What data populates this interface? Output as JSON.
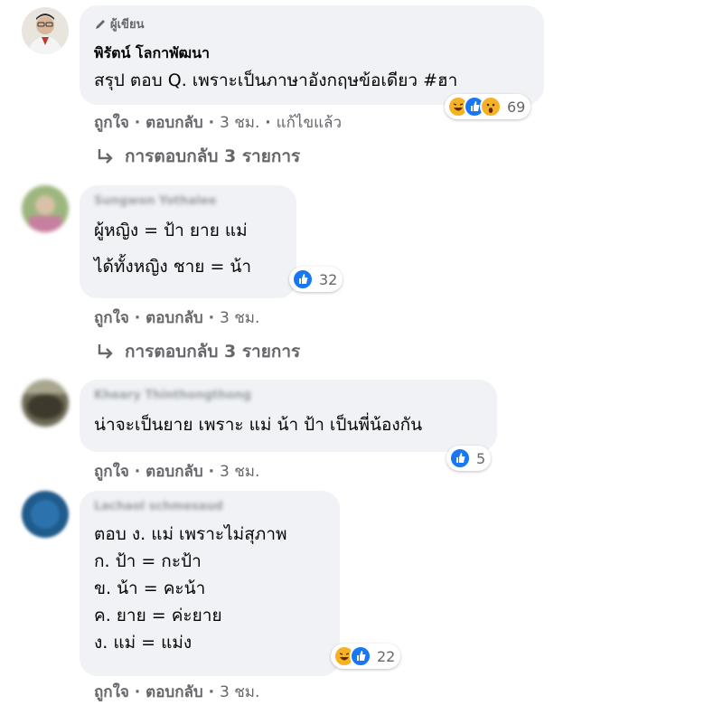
{
  "comments": [
    {
      "author_badge": "ผู้เขียน",
      "author": "พิรัตน์ โลกาพัฒนา",
      "lines": [
        "สรุป ตอบ Q. เพราะเป็นภาษาอังกฤษข้อเดียว #ฮา"
      ],
      "reaction_count": "69",
      "reactions": [
        "haha-icon",
        "like-icon",
        "wow-icon"
      ],
      "actions": {
        "like": "ถูกใจ",
        "reply": "ตอบกลับ",
        "time": "3 ชม.",
        "edited": "แก้ไขแล้ว"
      },
      "replies_label": "การตอบกลับ 3 รายการ"
    },
    {
      "author": "Sungwon Yothalee",
      "lines": [
        "ผู้หญิง = ป้า ยาย แม่",
        "ได้ทั้งหญิง ชาย = น้า"
      ],
      "reaction_count": "32",
      "reactions": [
        "like-icon"
      ],
      "actions": {
        "like": "ถูกใจ",
        "reply": "ตอบกลับ",
        "time": "3 ชม."
      },
      "replies_label": "การตอบกลับ 3 รายการ"
    },
    {
      "author": "Kheary Thinthongthong",
      "lines": [
        "น่าจะเป็นยาย เพราะ แม่ น้า ป้า เป็นพี่น้องกัน"
      ],
      "reaction_count": "5",
      "reactions": [
        "like-icon"
      ],
      "actions": {
        "like": "ถูกใจ",
        "reply": "ตอบกลับ",
        "time": "3 ชม."
      }
    },
    {
      "author": "Lachaol schmesaud",
      "lines": [
        "ตอบ ง. แม่ เพราะไม่สุภาพ",
        "ก. ป้า = กะป้า",
        "ข. น้า = คะน้า",
        "ค. ยาย = ค่ะยาย",
        "ง. แม่ = แม่ง"
      ],
      "reaction_count": "22",
      "reactions": [
        "haha-icon",
        "like-icon"
      ],
      "actions": {
        "like": "ถูกใจ",
        "reply": "ตอบกลับ",
        "time": "3 ชม."
      }
    }
  ],
  "colors": {
    "bubble": "#f0f2f5",
    "meta": "#65676b",
    "like": "#1877f2",
    "haha": "#f7b125"
  }
}
